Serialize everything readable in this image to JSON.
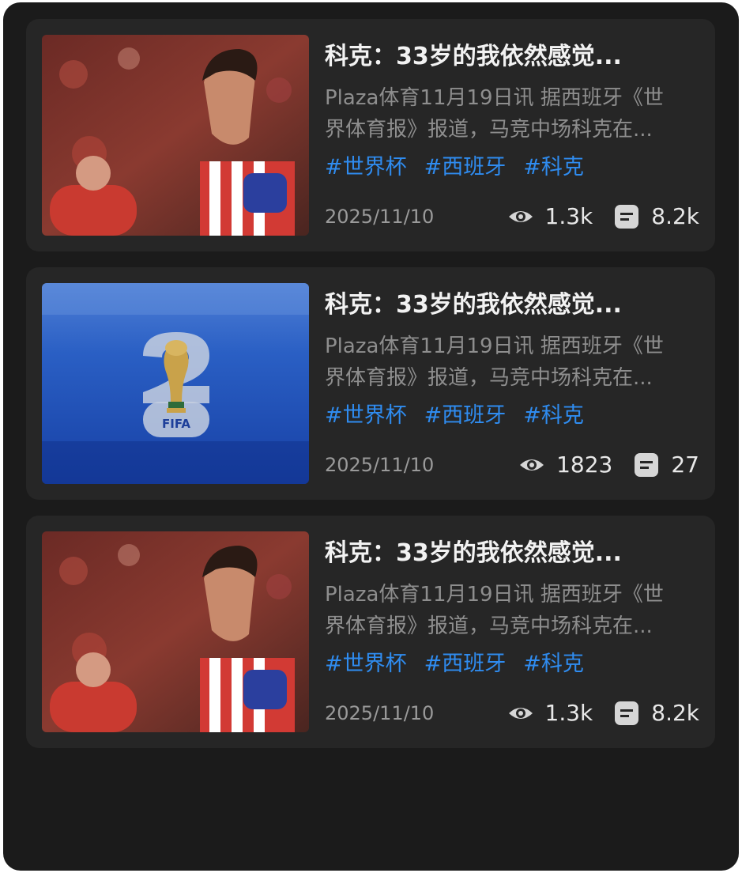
{
  "articles": [
    {
      "title": "科克：33岁的我依然感觉...",
      "summary_line1": "Plaza体育11月19日讯 据西班牙《世",
      "summary_line2": "界体育报》报道，马竞中场科克在...",
      "tags": [
        "#世界杯",
        "#西班牙",
        "#科克"
      ],
      "date": "2025/11/10",
      "views": "1.3k",
      "comments": "8.2k",
      "thumbnail": "player-photo"
    },
    {
      "title": "科克：33岁的我依然感觉...",
      "summary_line1": "Plaza体育11月19日讯 据西班牙《世",
      "summary_line2": "界体育报》报道，马竞中场科克在...",
      "tags": [
        "#世界杯",
        "#西班牙",
        "#科克"
      ],
      "date": "2025/11/10",
      "views": "1823",
      "comments": "27",
      "thumbnail": "fifa-26-logo",
      "thumbnail_text": "FIFA"
    },
    {
      "title": "科克：33岁的我依然感觉...",
      "summary_line1": "Plaza体育11月19日讯 据西班牙《世",
      "summary_line2": "界体育报》报道，马竞中场科克在...",
      "tags": [
        "#世界杯",
        "#西班牙",
        "#科克"
      ],
      "date": "2025/11/10",
      "views": "1.3k",
      "comments": "8.2k",
      "thumbnail": "player-photo"
    }
  ],
  "icons": {
    "views": "eye-icon",
    "comments": "comment-icon"
  },
  "colors": {
    "background": "#1b1b1b",
    "card": "#262626",
    "tag": "#2f8cf0",
    "title": "#f2f2f2",
    "summary": "#8e8e8e"
  }
}
